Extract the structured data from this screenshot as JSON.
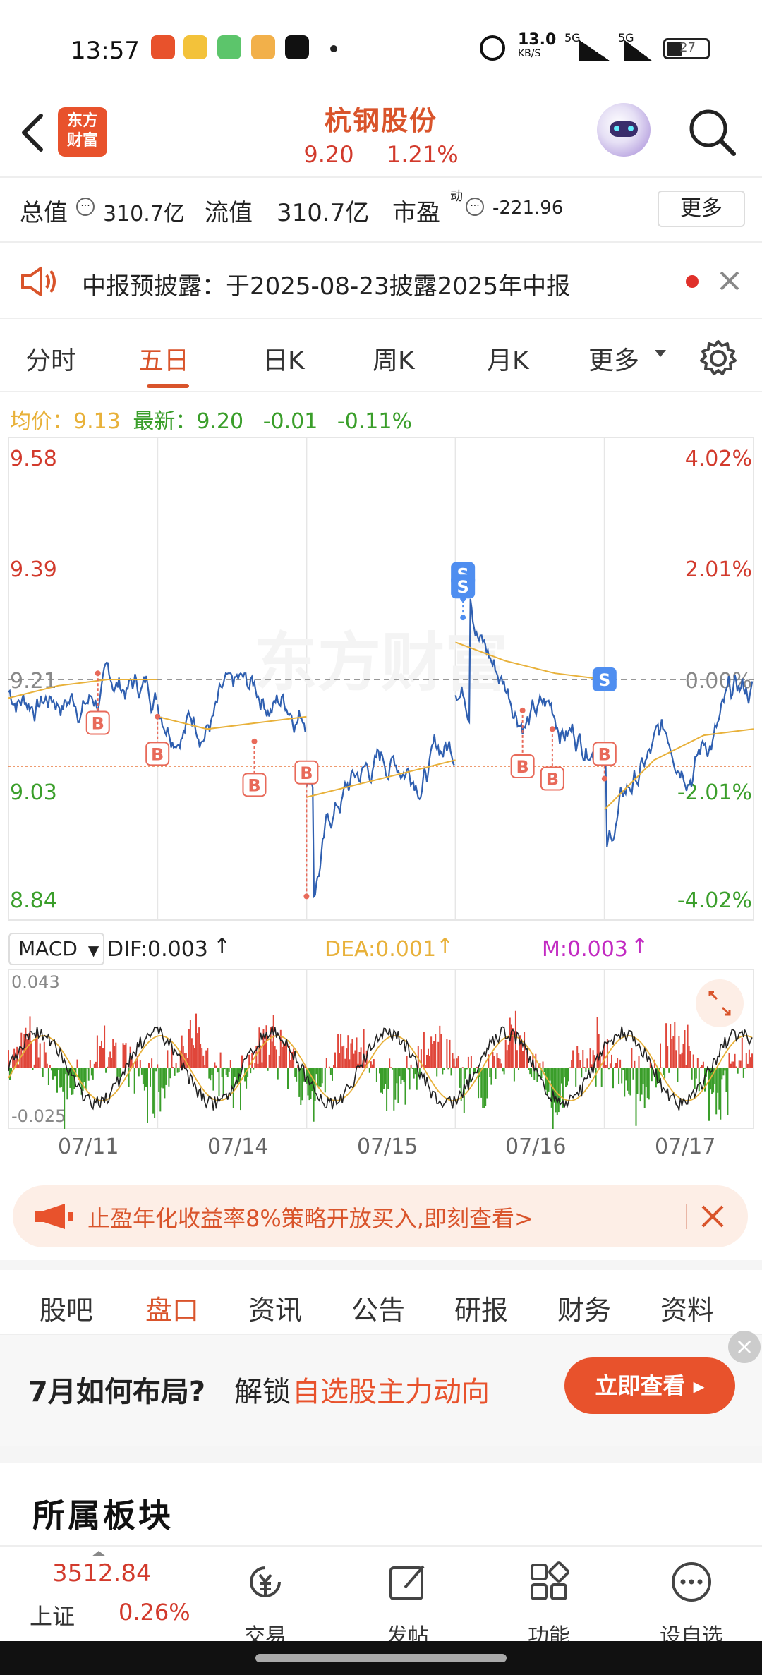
{
  "status_bar": {
    "time": "13:57",
    "network_speed": "13.0",
    "network_unit": "KB/S",
    "battery": "27",
    "signal1": "5G",
    "signal2": "5G"
  },
  "header": {
    "logo_line1": "东方",
    "logo_line2": "财富",
    "stock_name": "杭钢股份",
    "price": "9.20",
    "change_pct": "1.21%"
  },
  "metrics": {
    "total_value_label": "总值",
    "total_value": "310.7亿",
    "float_value_label": "流值",
    "float_value": "310.7亿",
    "pe_label": "市盈",
    "pe_sup": "动",
    "pe_value": "-221.96",
    "more_label": "更多"
  },
  "notice": {
    "text": "中报预披露：于2025-08-23披露2025年中报"
  },
  "tabs": [
    {
      "label": "分时"
    },
    {
      "label": "五日"
    },
    {
      "label": "日K"
    },
    {
      "label": "周K"
    },
    {
      "label": "月K"
    },
    {
      "label": "更多"
    }
  ],
  "legend": {
    "avg_label": "均价：",
    "avg_value": "9.13",
    "latest_label": "最新：",
    "latest_value": "9.20",
    "change": "-0.01",
    "change_pct": "-0.11%"
  },
  "chart_data": {
    "type": "line",
    "y_left_ticks": [
      "9.58",
      "9.39",
      "9.21",
      "9.03",
      "8.84"
    ],
    "y_right_ticks": [
      "4.02%",
      "2.01%",
      "0.00%",
      "-2.01%",
      "-4.02%"
    ],
    "x_labels": [
      "07/11",
      "07/14",
      "07/15",
      "07/16",
      "07/17"
    ],
    "ylim": [
      8.84,
      9.58
    ],
    "prev_close": 9.21,
    "watermark": "东方财富",
    "markers": [
      "B",
      "B",
      "B",
      "B",
      "S",
      "S",
      "B",
      "B",
      "S",
      "B"
    ],
    "colors": {
      "price": "#2f5fb0",
      "avg": "#e8b13a",
      "up": "#e0463a",
      "down": "#3a9e2a"
    }
  },
  "macd": {
    "selector": "MACD",
    "dif": "DIF:0.003",
    "dea": "DEA:0.001",
    "m": "M:0.003",
    "top_label": "0.043",
    "bottom_label": "-0.025"
  },
  "ad": {
    "text": "止盈年化收益率8%策略开放买入,即刻查看>"
  },
  "section_tabs": [
    {
      "label": "股吧"
    },
    {
      "label": "盘口"
    },
    {
      "label": "资讯"
    },
    {
      "label": "公告"
    },
    {
      "label": "研报"
    },
    {
      "label": "财务"
    },
    {
      "label": "资料"
    }
  ],
  "promo": {
    "t1": "7月如何布局?",
    "t2": "解锁",
    "t3": "自选股主力动向",
    "button": "立即查看 ▸"
  },
  "section_title": "所属板块",
  "bottom_nav": {
    "index_value": "3512.84",
    "index_name": "上证",
    "index_change": "0.26%",
    "items": [
      {
        "label": "交易"
      },
      {
        "label": "发帖"
      },
      {
        "label": "功能"
      },
      {
        "label": "设自选"
      }
    ]
  }
}
